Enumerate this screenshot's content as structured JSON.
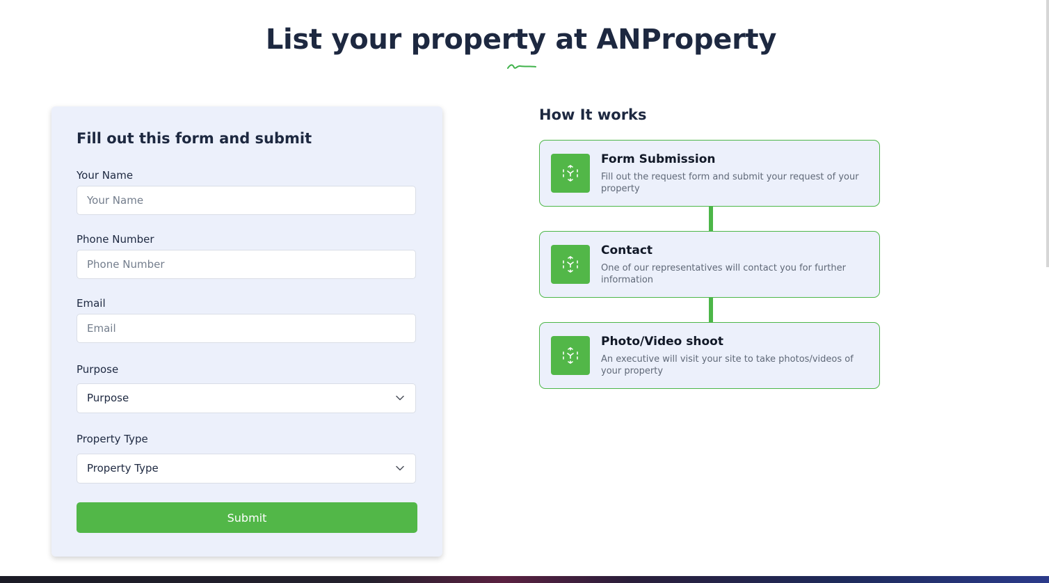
{
  "page": {
    "title": "List your property at ANProperty"
  },
  "form": {
    "heading": "Fill out this form and submit",
    "fields": [
      {
        "label": "Your Name",
        "placeholder": "Your Name"
      },
      {
        "label": "Phone Number",
        "placeholder": "Phone Number"
      },
      {
        "label": "Email",
        "placeholder": "Email"
      }
    ],
    "purpose": {
      "label": "Purpose",
      "value": "Purpose"
    },
    "property_type": {
      "label": "Property Type",
      "value": "Property Type"
    },
    "submit_label": "Submit"
  },
  "how_it_works": {
    "heading": "How It works",
    "steps": [
      {
        "title": "Form Submission",
        "description": "Fill out the request form and submit your request of your property",
        "icon": "scan-cube-icon"
      },
      {
        "title": "Contact",
        "description": "One of our representatives will contact you for further information",
        "icon": "scan-cube-icon"
      },
      {
        "title": "Photo/Video shoot",
        "description": "An executive will visit your site to take photos/videos of your property",
        "icon": "scan-cube-icon"
      }
    ]
  },
  "colors": {
    "accent": "#52b748",
    "card_background": "#ecf0fb",
    "heading_text": "#1d2840"
  }
}
